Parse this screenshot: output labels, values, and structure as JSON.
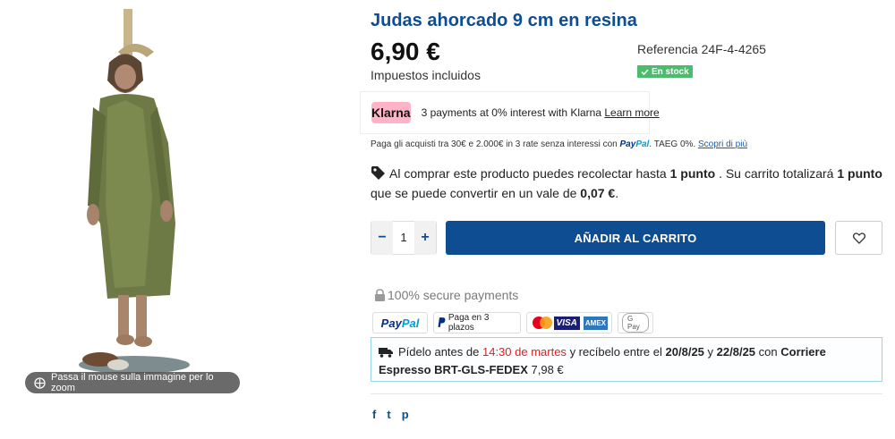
{
  "image": {
    "zoom_hint": "Passa il mouse sulla immagine per lo zoom"
  },
  "product": {
    "title": "Judas ahorcado 9 cm en resina",
    "price": "6,90 €",
    "taxes_label": "Impuestos incluidos",
    "reference": "Referencia 24F-4-4265",
    "stock_label": "En stock",
    "stock_color": "#4cbb6c",
    "brand_color": "#0f4d92"
  },
  "klarna": {
    "badge": "Klarna",
    "text": "3 payments at 0% interest with Klarna",
    "link": "Learn more"
  },
  "paypal_installments": {
    "text_before": "Paga gli acquisti tra 30€ e 2.000€ in 3 rate senza interessi con",
    "brand_a": "Pay",
    "brand_b": "Pal",
    "text_after": ". TAEG 0%.",
    "link": "Scopri di più"
  },
  "loyalty": {
    "part1": "Al comprar este producto puedes recolectar hasta",
    "points1": "1 punto",
    "part2": ". Su carrito totalizará",
    "points2": "1 punto",
    "part3": "que se puede convertir en un vale de",
    "value": "0,07 €",
    "end": "."
  },
  "cart": {
    "minus": "−",
    "quantity": "1",
    "plus": "+",
    "add_label": "AÑADIR AL CARRITO"
  },
  "payments": {
    "secure_label": "100% secure payments",
    "paypal_a": "Pay",
    "paypal_b": "Pal",
    "installments_label": "Paga en 3 plazos",
    "visa": "VISA",
    "amex": "AMEX",
    "gpay": "G Pay"
  },
  "delivery": {
    "part1": "Pídelo antes de",
    "deadline": "14:30 de martes",
    "part2": "y recíbelo entre el",
    "date1": "20/8/25",
    "and": "y",
    "date2": "22/8/25",
    "with": "con",
    "carrier": "Corriere Espresso BRT-GLS-FEDEX",
    "cost": "7,98 €"
  },
  "social": {
    "facebook": "f",
    "twitter": "t",
    "pinterest": "p"
  }
}
